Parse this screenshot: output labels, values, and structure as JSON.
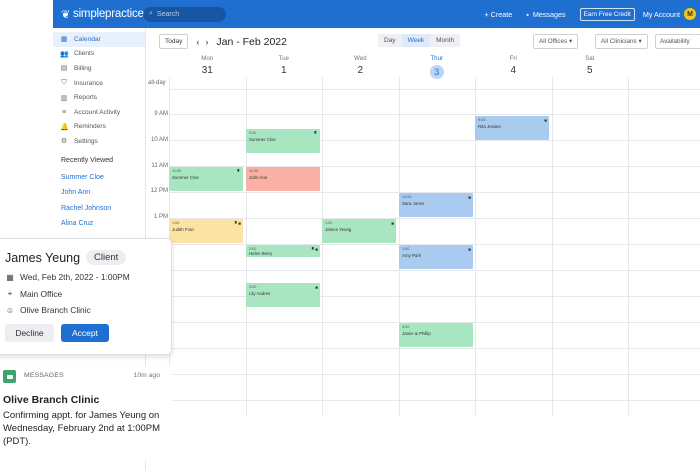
{
  "topbar": {
    "logo": "simplepractice",
    "search_placeholder": "Search",
    "create": "+ Create",
    "messages": "Messages",
    "earn": "Earn Free Credit",
    "account": "My Account",
    "avatar_initial": "M"
  },
  "sidebar": {
    "items": [
      {
        "label": "Calendar",
        "icon": "calendar-icon"
      },
      {
        "label": "Clients",
        "icon": "clients-icon"
      },
      {
        "label": "Billing",
        "icon": "billing-icon"
      },
      {
        "label": "Insurance",
        "icon": "shield-icon"
      },
      {
        "label": "Reports",
        "icon": "reports-icon"
      },
      {
        "label": "Account Activity",
        "icon": "activity-icon"
      },
      {
        "label": "Reminders",
        "icon": "bell-icon"
      },
      {
        "label": "Settings",
        "icon": "gear-icon"
      }
    ],
    "recent_heading": "Recently Viewed",
    "recent": [
      "Summer Cloe",
      "John Ann",
      "Rachel Johnson",
      "Alina Cruz"
    ]
  },
  "toolbar": {
    "today": "Today",
    "prev": "‹",
    "next": "›",
    "title": "Jan - Feb 2022",
    "views": [
      "Day",
      "Week",
      "Month"
    ],
    "offices": "All Offices",
    "clinicians": "All Clinicians",
    "availability": "Availability"
  },
  "calendar": {
    "days": [
      {
        "name": "Mon",
        "date": "31"
      },
      {
        "name": "Tue",
        "date": "1"
      },
      {
        "name": "Wed",
        "date": "2"
      },
      {
        "name": "Thur",
        "date": "3"
      },
      {
        "name": "Fri",
        "date": "4"
      },
      {
        "name": "Sat",
        "date": "5"
      }
    ],
    "allday": "all-day",
    "times": [
      "9 AM",
      "10 AM",
      "11 AM",
      "12 PM",
      "1 PM"
    ],
    "appointments": [
      {
        "name": "Summer Cloe",
        "time": "9:30",
        "color": "#a8e6c2"
      },
      {
        "name": "Rita Jessen",
        "time": "9:00",
        "color": "#a9cbf0"
      },
      {
        "name": "Summer Cloe",
        "time": "11:00",
        "color": "#a8e6c2"
      },
      {
        "name": "John Ann",
        "time": "11:00",
        "color": "#f8b1a4"
      },
      {
        "name": "Sara Jones",
        "time": "12:00",
        "color": "#a9cbf0"
      },
      {
        "name": "Judith Fran",
        "time": "1:00",
        "color": "#fce3a4"
      },
      {
        "name": "James Yeung",
        "time": "1:00",
        "color": "#a8e6c2"
      },
      {
        "name": "Helen Berry",
        "time": "2:00",
        "color": "#a8e6c2"
      },
      {
        "name": "Amy Park",
        "time": "2:00",
        "color": "#a9cbf0"
      },
      {
        "name": "Lily Andres",
        "time": "3:00",
        "color": "#a8e6c2"
      },
      {
        "name": "Jamie & Phillip",
        "time": "4:00",
        "color": "#a8e6c2"
      }
    ]
  },
  "request": {
    "name": "James Yeung",
    "badge": "Client",
    "datetime": "Wed, Feb 2th, 2022 - 1:00PM",
    "office": "Main Office",
    "clinic": "Olive Branch Clinic",
    "decline": "Decline",
    "accept": "Accept"
  },
  "message": {
    "label": "MESSAGES",
    "time": "10m ago",
    "title": "Olive Branch Clinic",
    "body": "Confirming appt. for James Yeung on Wednesday, February 2nd at 1:00PM (PDT)."
  },
  "colors": {
    "brand_blue": "#1f6fd0",
    "appt_green": "#a8e6c2",
    "appt_blue": "#a9cbf0",
    "appt_salmon": "#f8b1a4",
    "appt_yellow": "#fce3a4",
    "message_green": "#3fa36a"
  }
}
